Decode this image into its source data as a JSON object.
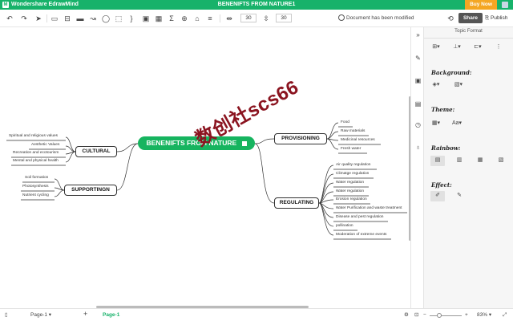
{
  "titlebar": {
    "app_name": "Wondershare EdrawMind",
    "document_title": "BENENIFTS FROM NATURE1",
    "buy_label": "Buy Now"
  },
  "toolbar": {
    "spacing_h": "30",
    "spacing_v": "30",
    "status_text": "Document has been modified",
    "share_label": "Share",
    "publish_label": "Publish"
  },
  "mindmap": {
    "central": "BENENIFTS FROM NATURE",
    "watermark": "数创社scs66",
    "branches": {
      "provisioning": {
        "label": "PROVISIONING",
        "items": [
          "Food",
          "Raw materials",
          "Medicinal resources",
          "Fresh water"
        ]
      },
      "regulating": {
        "label": "REGULATING",
        "items": [
          "Air quality regulation",
          "Climatge regulation",
          "Water regulation",
          "Water regulation",
          "Erosion regulation",
          "Water Purification and waste treatment",
          "Disease and pest regulation",
          "pollination",
          "Moderation of extreme events"
        ]
      },
      "cultural": {
        "label": "CULTURAL",
        "items": [
          "Spiritual and religious values",
          "Aesthetic Values",
          "Recreation and ecotourism",
          "Mental and physical health"
        ]
      },
      "supporting": {
        "label": "SUPPORTINGN",
        "items": [
          "Soil formation",
          "Photosynthesis",
          "Nutrient cycling"
        ]
      }
    }
  },
  "panel": {
    "title": "Topic Format",
    "background_label": "Background:",
    "theme_label": "Theme:",
    "theme_font": "Aa",
    "rainbow_label": "Rainbow:",
    "effect_label": "Effect:"
  },
  "statusbar": {
    "page_tab": "Page-1",
    "add_page": "+",
    "active_page": "Page-1",
    "zoom": "83%"
  },
  "colors": {
    "brand": "#17b26a",
    "central_node": "#16b45f",
    "buy_button": "#f4a623",
    "watermark": "#8b1420"
  },
  "icons": [
    "undo-icon",
    "redo-icon",
    "send-icon",
    "topic-icon",
    "subtopic-icon",
    "floating-topic-icon",
    "relationship-icon",
    "callout-icon",
    "boundary-icon",
    "summary-icon",
    "image-icon",
    "table-icon",
    "formula-icon",
    "share-icon",
    "publish-icon",
    "collapse-panel-icon",
    "paint-icon",
    "image-panel-icon",
    "page-style-icon",
    "clock-icon",
    "idea-icon",
    "fit-icon",
    "fullscreen-icon"
  ]
}
